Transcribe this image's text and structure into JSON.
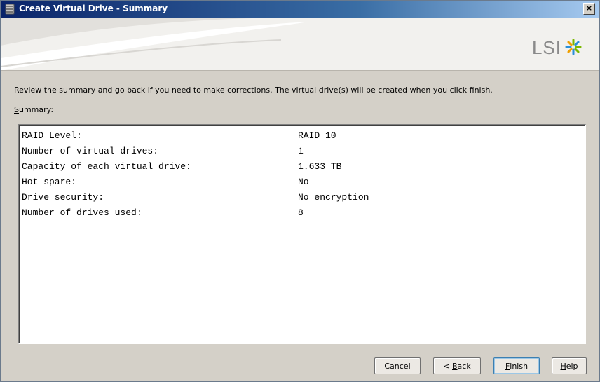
{
  "window": {
    "title": "Create Virtual Drive - Summary",
    "close_label": "×"
  },
  "header": {
    "logo_text": "LSI"
  },
  "instruction": "Review the summary and go back if you need to make corrections. The virtual drive(s) will be created when you click finish.",
  "summary": {
    "label_accel": "S",
    "label_rest": "ummary:",
    "rows": [
      {
        "label": "RAID Level:",
        "value": "RAID 10"
      },
      {
        "label": "Number of virtual drives:",
        "value": "1"
      },
      {
        "label": "Capacity of each virtual drive:",
        "value": "1.633 TB"
      },
      {
        "label": "Hot spare:",
        "value": "No"
      },
      {
        "label": "Drive security:",
        "value": "No encryption"
      },
      {
        "label": "Number of drives used:",
        "value": "8"
      }
    ]
  },
  "buttons": {
    "cancel": "Cancel",
    "back_prefix": "< ",
    "back_accel": "B",
    "back_rest": "ack",
    "finish_accel": "F",
    "finish_rest": "inish",
    "help_accel": "H",
    "help_rest": "elp"
  },
  "colors": {
    "titlebar_start": "#0a246a",
    "window_bg": "#d4d0c8",
    "logo_accent_green": "#7ab800",
    "logo_accent_blue": "#2a8fd8"
  }
}
